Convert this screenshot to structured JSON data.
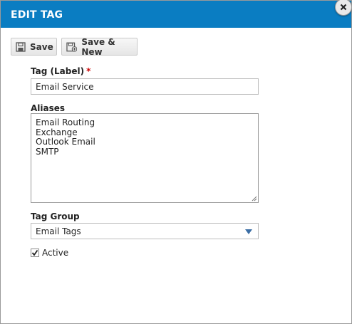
{
  "dialog": {
    "title": "EDIT TAG",
    "close_icon": "close-icon",
    "accent_color": "#0a7dc2"
  },
  "toolbar": {
    "save_label": "Save",
    "save_icon": "floppy-disk-icon",
    "save_new_label": "Save & New",
    "save_new_icon": "floppy-disk-plus-icon"
  },
  "form": {
    "tag_label": {
      "label": "Tag (Label)",
      "required_mark": "*",
      "value": "Email Service"
    },
    "aliases": {
      "label": "Aliases",
      "values": [
        "Email Routing",
        "Exchange",
        "Outlook Email",
        "SMTP"
      ]
    },
    "tag_group": {
      "label": "Tag Group",
      "value": "Email Tags",
      "arrow_icon": "dropdown-arrow-icon"
    },
    "active": {
      "label": "Active",
      "checked": true
    }
  }
}
